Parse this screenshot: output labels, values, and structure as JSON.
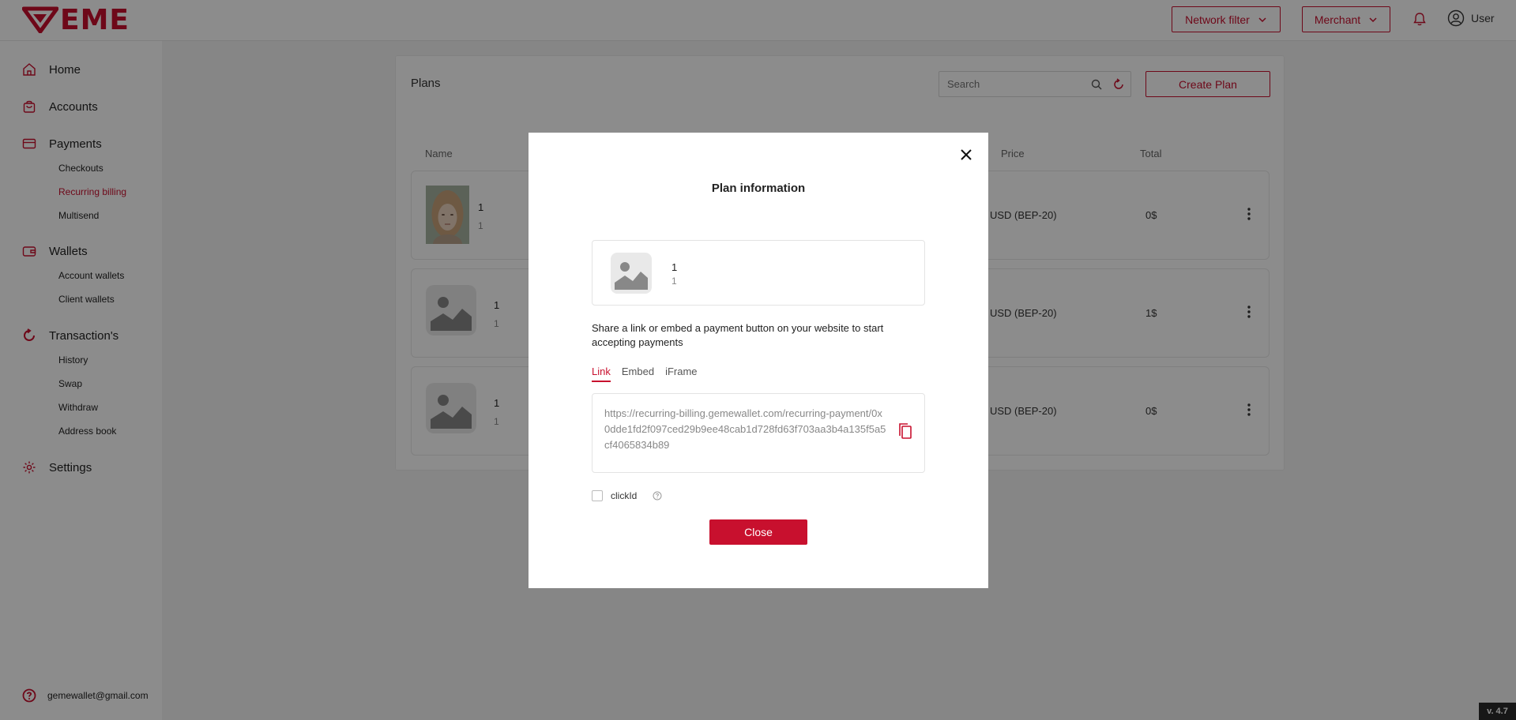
{
  "header": {
    "logo_text": "EME",
    "network_filter": "Network filter",
    "merchant": "Merchant",
    "user": "User"
  },
  "sidebar": {
    "home": "Home",
    "accounts": "Accounts",
    "payments": "Payments",
    "checkouts": "Checkouts",
    "recurring_billing": "Recurring billing",
    "multisend": "Multisend",
    "wallets": "Wallets",
    "account_wallets": "Account wallets",
    "client_wallets": "Client wallets",
    "transactions": "Transaction's",
    "history": "History",
    "swap": "Swap",
    "withdraw": "Withdraw",
    "address_book": "Address book",
    "settings": "Settings",
    "email": "gemewallet@gmail.com"
  },
  "plans": {
    "title": "Plans",
    "search_placeholder": "Search",
    "create_button": "Create Plan",
    "columns": {
      "name": "Name",
      "price": "Price",
      "total": "Total"
    },
    "rows": [
      {
        "name": "1",
        "sub": "1",
        "price": "USD (BEP-20)",
        "total": "0$"
      },
      {
        "name": "1",
        "sub": "1",
        "price": "USD (BEP-20)",
        "total": "1$"
      },
      {
        "name": "1",
        "sub": "1",
        "price": "USD (BEP-20)",
        "total": "0$"
      }
    ]
  },
  "modal": {
    "title": "Plan information",
    "plan_name": "1",
    "plan_sub": "1",
    "share_text": "Share a link or embed a payment button on your website to start accepting payments",
    "tabs": [
      "Link",
      "Embed",
      "iFrame"
    ],
    "link": "https://recurring-billing.gemewallet.com/recurring-payment/0x0dde1fd2f097ced29b9ee48cab1d728fd63f703aa3b4a135f5a5cf4065834b89",
    "clickid_label": "clickId",
    "close_button": "Close"
  },
  "version": "v. 4.7",
  "colors": {
    "accent": "#c8102e"
  }
}
